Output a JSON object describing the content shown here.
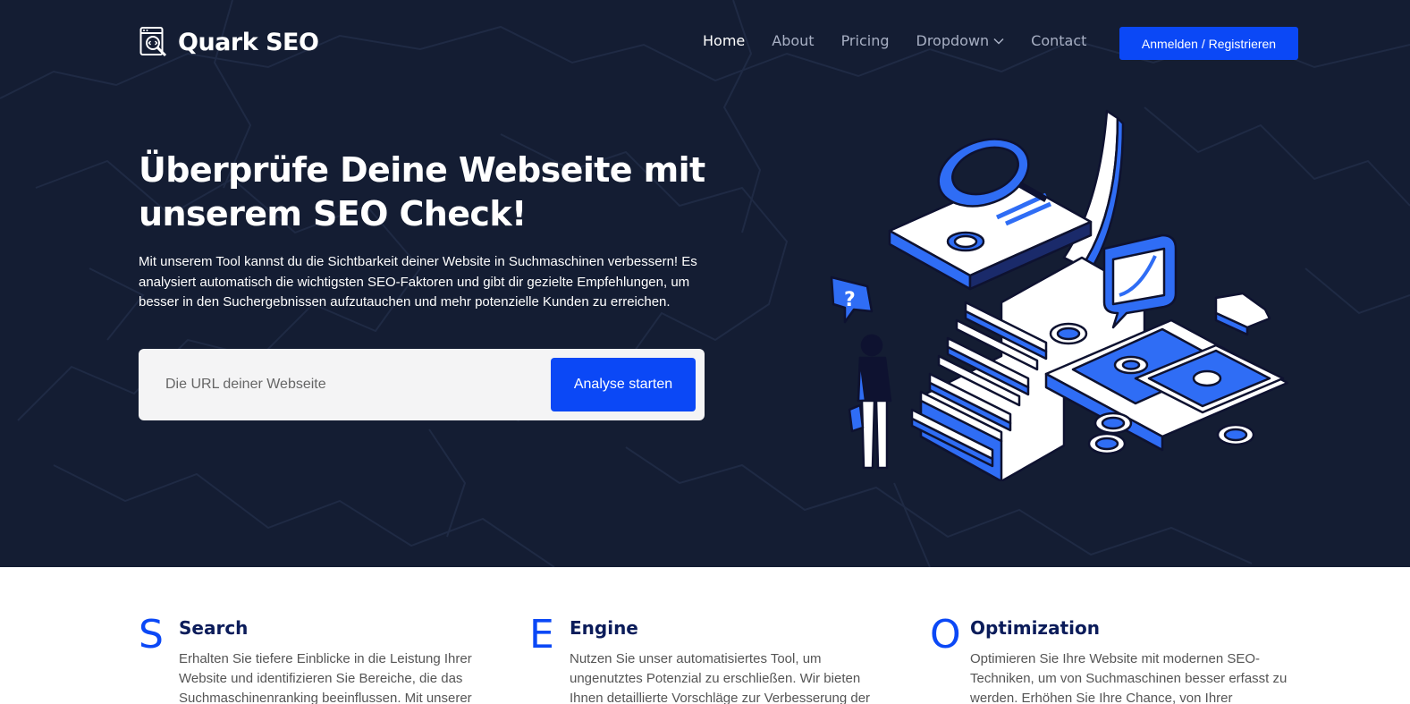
{
  "brand": {
    "name": "Quark SEO",
    "icon": "seo-code-magnifier-icon"
  },
  "nav": {
    "items": [
      {
        "label": "Home",
        "active": true
      },
      {
        "label": "About",
        "active": false
      },
      {
        "label": "Pricing",
        "active": false
      },
      {
        "label": "Dropdown",
        "active": false,
        "has_dropdown": true
      },
      {
        "label": "Contact",
        "active": false
      }
    ],
    "cta_label": "Anmelden / Registrieren"
  },
  "hero": {
    "title": "Überprüfe Deine Webseite mit unserem SEO Check!",
    "description": "Mit unserem Tool kannst du die Sichtbarkeit deiner Website in Suchmaschinen verbessern! Es analysiert automatisch die wichtigsten SEO-Faktoren und gibt dir gezielte Empfehlungen, um besser in den Suchergebnissen aufzutauchen und mehr potenzielle Kunden zu erreichen.",
    "search": {
      "value": "",
      "placeholder": "Die URL deiner Webseite",
      "button_label": "Analyse starten"
    },
    "illustration": "isometric-seo-stairs-money-magnifier-illustration"
  },
  "features": [
    {
      "letter": "S",
      "title": "Search",
      "text": "Erhalten Sie tiefere Einblicke in die Leistung Ihrer Website und identifizieren Sie Bereiche, die das Suchmaschinenranking beeinflussen. Mit unserer"
    },
    {
      "letter": "E",
      "title": "Engine",
      "text": "Nutzen Sie unser automatisiertes Tool, um ungenutztes Potenzial zu erschließen. Wir bieten Ihnen detaillierte Vorschläge zur Verbesserung der Performance und"
    },
    {
      "letter": "O",
      "title": "Optimization",
      "text": "Optimieren Sie Ihre Website mit modernen SEO-Techniken, um von Suchmaschinen besser erfasst zu werden. Erhöhen Sie Ihre Chance, von Ihrer Zielgruppe"
    }
  ],
  "colors": {
    "hero_bg": "#141d33",
    "accent": "#0b48f6",
    "feature_title": "#0b1c5a"
  }
}
